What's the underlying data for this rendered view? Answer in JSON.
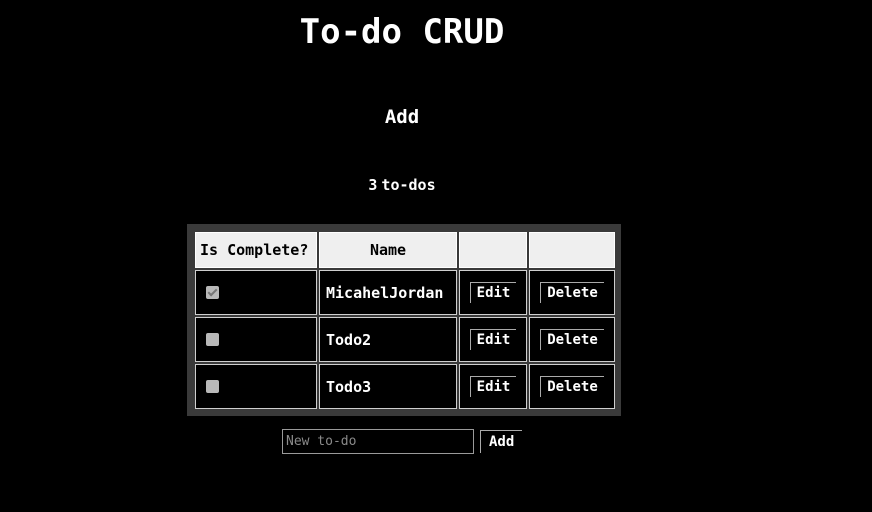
{
  "app": {
    "title": "To-do CRUD",
    "add_heading": "Add"
  },
  "summary": {
    "count": "3",
    "label": "to-dos"
  },
  "table": {
    "headers": {
      "complete": "Is Complete?",
      "name": "Name",
      "edit": "",
      "delete": ""
    },
    "rows": [
      {
        "complete": true,
        "name": "MicahelJordan",
        "edit_label": "Edit",
        "delete_label": "Delete"
      },
      {
        "complete": false,
        "name": "Todo2",
        "edit_label": "Edit",
        "delete_label": "Delete"
      },
      {
        "complete": false,
        "name": "Todo3",
        "edit_label": "Edit",
        "delete_label": "Delete"
      }
    ]
  },
  "form": {
    "input_value": "",
    "input_placeholder": "New to-do",
    "add_label": "Add"
  },
  "colors": {
    "background": "#000000",
    "text": "#ffffff",
    "table_frame": "#3a3a3a",
    "header_bg": "#efefef"
  }
}
